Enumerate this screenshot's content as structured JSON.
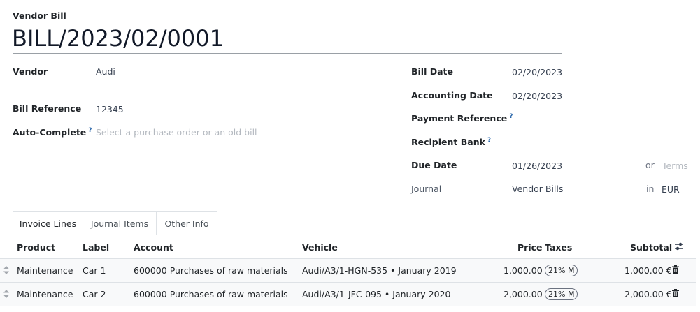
{
  "header": {
    "doc_type": "Vendor Bill",
    "bill_number": "BILL/2023/02/0001"
  },
  "left_fields": {
    "vendor_label": "Vendor",
    "vendor_value": "Audi",
    "bill_reference_label": "Bill Reference",
    "bill_reference_value": "12345",
    "auto_complete_label": "Auto-Complete",
    "auto_complete_help": "?",
    "auto_complete_placeholder": "Select a purchase order or an old bill"
  },
  "right_fields": {
    "bill_date_label": "Bill Date",
    "bill_date_value": "02/20/2023",
    "accounting_date_label": "Accounting Date",
    "accounting_date_value": "02/20/2023",
    "payment_reference_label": "Payment Reference",
    "payment_reference_help": "?",
    "recipient_bank_label": "Recipient Bank",
    "recipient_bank_help": "?",
    "due_date_label": "Due Date",
    "due_date_value": "01/26/2023",
    "or_text": "or",
    "terms_placeholder": "Terms",
    "journal_label": "Journal",
    "journal_value": "Vendor Bills",
    "in_text": "in",
    "currency_value": "EUR"
  },
  "tabs": [
    {
      "label": "Invoice Lines",
      "active": true
    },
    {
      "label": "Journal Items",
      "active": false
    },
    {
      "label": "Other Info",
      "active": false
    }
  ],
  "table": {
    "columns": {
      "product": "Product",
      "label": "Label",
      "account": "Account",
      "vehicle": "Vehicle",
      "price": "Price",
      "taxes": "Taxes",
      "subtotal": "Subtotal"
    },
    "rows": [
      {
        "product": "Maintenance",
        "label": "Car 1",
        "account": "600000 Purchases of raw materials",
        "vehicle": "Audi/A3/1-HGN-535 • January 2019",
        "price": "1,000.00",
        "tax": "21% M",
        "subtotal": "1,000.00 €"
      },
      {
        "product": "Maintenance",
        "label": "Car 2",
        "account": "600000 Purchases of raw materials",
        "vehicle": "Audi/A3/1-JFC-095 • January 2020",
        "price": "2,000.00",
        "tax": "21% M",
        "subtotal": "2,000.00 €"
      }
    ]
  },
  "icons": {
    "column_settings": "sliders-icon",
    "row_handle": "drag-handle-icon",
    "row_delete": "trash-icon"
  },
  "colors": {
    "help_marker": "#2563a8",
    "row_background": "#f8f9fa",
    "border": "#dee2e6"
  }
}
